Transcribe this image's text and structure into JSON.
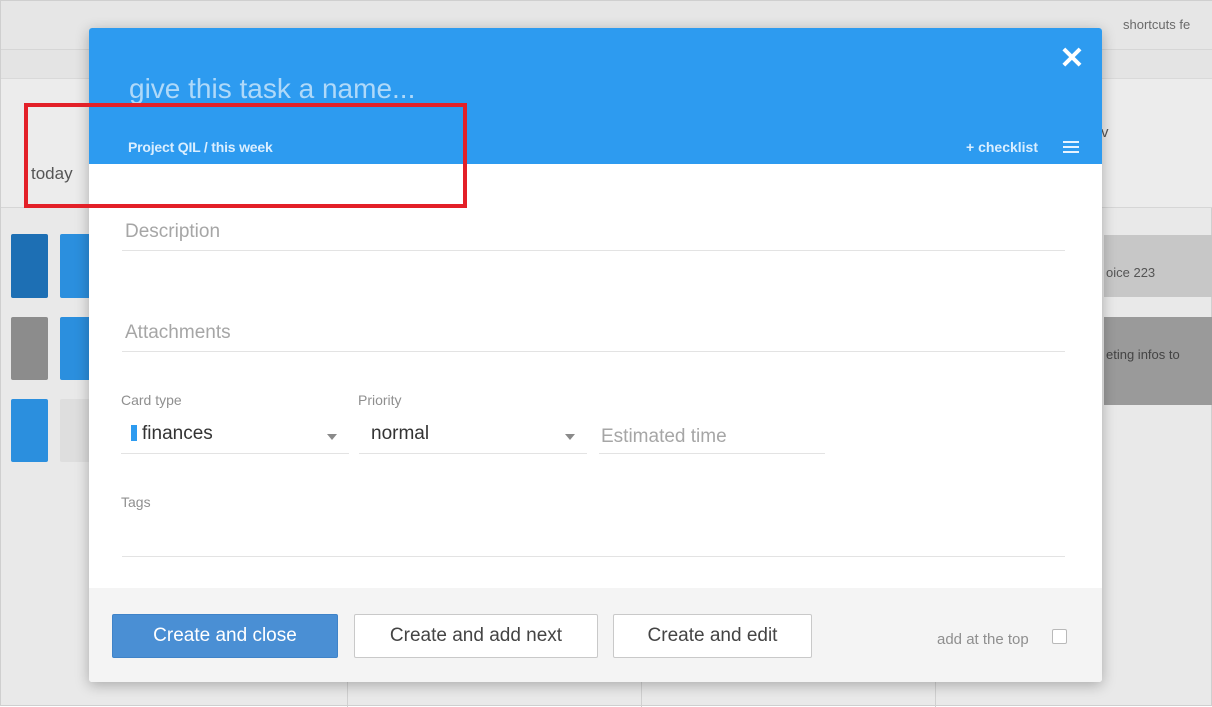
{
  "background": {
    "topbar": {
      "shortcuts_text": "shortcuts fe"
    },
    "column_today": "today",
    "column_partial_letter": "v",
    "right_cards": [
      {
        "text": "oice 223"
      },
      {
        "text": "eting infos to"
      }
    ]
  },
  "modal": {
    "task_name_placeholder": "give this task a name...",
    "close_icon_glyph": "✕",
    "breadcrumb": "Project QIL / this week",
    "checklist_label": "+ checklist",
    "fields": {
      "description_placeholder": "Description",
      "attachments_placeholder": "Attachments",
      "card_type_label": "Card type",
      "card_type_value": "finances",
      "card_type_color": "#2d9bf0",
      "priority_label": "Priority",
      "priority_value": "normal",
      "estimated_time_placeholder": "Estimated time",
      "tags_label": "Tags"
    },
    "footer": {
      "create_close": "Create and close",
      "create_next": "Create and add next",
      "create_edit": "Create and edit",
      "add_top_label": "add at the top",
      "add_top_checked": false
    }
  },
  "colors": {
    "header_blue": "#2d9bf0",
    "primary_button": "#4a8fd4",
    "highlight_red": "#e32028"
  }
}
